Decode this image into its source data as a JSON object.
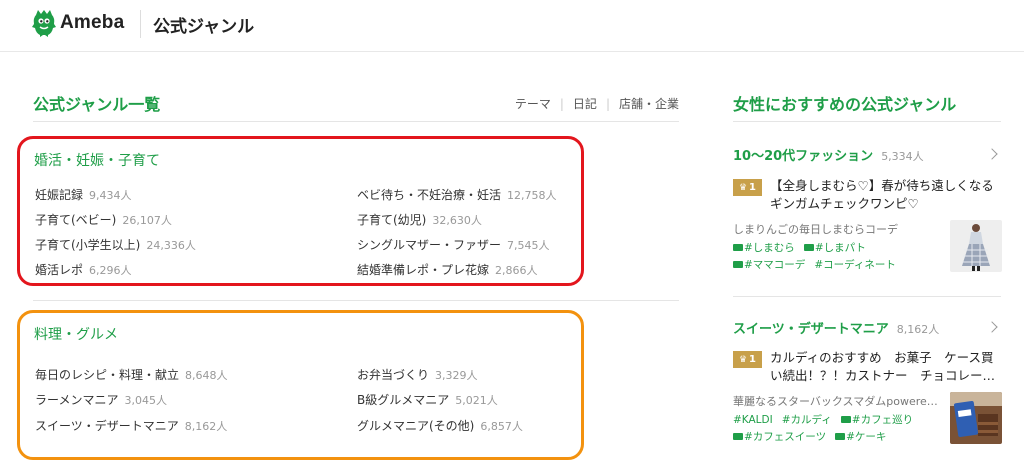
{
  "header": {
    "logo_text": "Ameba",
    "title": "公式ジャンル"
  },
  "main": {
    "title": "公式ジャンル一覧",
    "filters": [
      "テーマ",
      "日記",
      "店舗・企業"
    ],
    "groups": [
      {
        "title": "婚活・妊娠・子育て",
        "highlight_color": "#e3161d",
        "items": [
          {
            "name": "妊娠記録",
            "count": "9,434人"
          },
          {
            "name": "ベビ待ち・不妊治療・妊活",
            "count": "12,758人"
          },
          {
            "name": "子育て(ベビー)",
            "count": "26,107人"
          },
          {
            "name": "子育て(幼児)",
            "count": "32,630人"
          },
          {
            "name": "子育て(小学生以上)",
            "count": "24,336人"
          },
          {
            "name": "シングルマザー・ファザー",
            "count": "7,545人"
          },
          {
            "name": "婚活レポ",
            "count": "6,296人"
          },
          {
            "name": "結婚準備レポ・プレ花嫁",
            "count": "2,866人"
          }
        ]
      },
      {
        "title": "料理・グルメ",
        "highlight_color": "#f3920f",
        "items": [
          {
            "name": "毎日のレシピ・料理・献立",
            "count": "8,648人"
          },
          {
            "name": "お弁当づくり",
            "count": "3,329人"
          },
          {
            "name": "ラーメンマニア",
            "count": "3,045人"
          },
          {
            "name": "B級グルメマニア",
            "count": "5,021人"
          },
          {
            "name": "スイーツ・デザートマニア",
            "count": "8,162人"
          },
          {
            "name": "グルメマニア(その他)",
            "count": "6,857人"
          }
        ]
      }
    ]
  },
  "sidebar": {
    "title": "女性におすすめの公式ジャンル",
    "cards": [
      {
        "genre": "10〜20代ファッション",
        "count": "5,334人",
        "rank": "1",
        "entry_title": "【全身しまむら♡】春が待ち遠しくなるギンガムチェックワンピ♡",
        "author": "しまりんごの毎日しまむらコーデ",
        "tags": [
          {
            "label": "#しまむら",
            "icon": "tag-icon"
          },
          {
            "label": "#しまパト",
            "icon": "tag-icon"
          },
          {
            "label": "#ママコーデ",
            "icon": "tag-icon"
          },
          {
            "label": "#コーディネート",
            "icon": ""
          }
        ]
      },
      {
        "genre": "スイーツ・デザートマニア",
        "count": "8,162人",
        "rank": "1",
        "entry_title": "カルディのおすすめ　お菓子　ケース買い続出！？！カストナー　チョコレー…",
        "author": "華麗なるスターバックスマダムpowered…",
        "tags": [
          {
            "label": "#KALDI",
            "icon": ""
          },
          {
            "label": "#カルディ",
            "icon": ""
          },
          {
            "label": "#カフェ巡り",
            "icon": "tag-icon"
          },
          {
            "label": "#カフェスイーツ",
            "icon": "tag-icon"
          },
          {
            "label": "#ケーキ",
            "icon": "tag-icon"
          }
        ]
      }
    ]
  },
  "colors": {
    "brand_green": "#1f9e48",
    "rank_gold": "#c8a04a",
    "red_highlight": "#e3161d",
    "orange_highlight": "#f3920f"
  }
}
